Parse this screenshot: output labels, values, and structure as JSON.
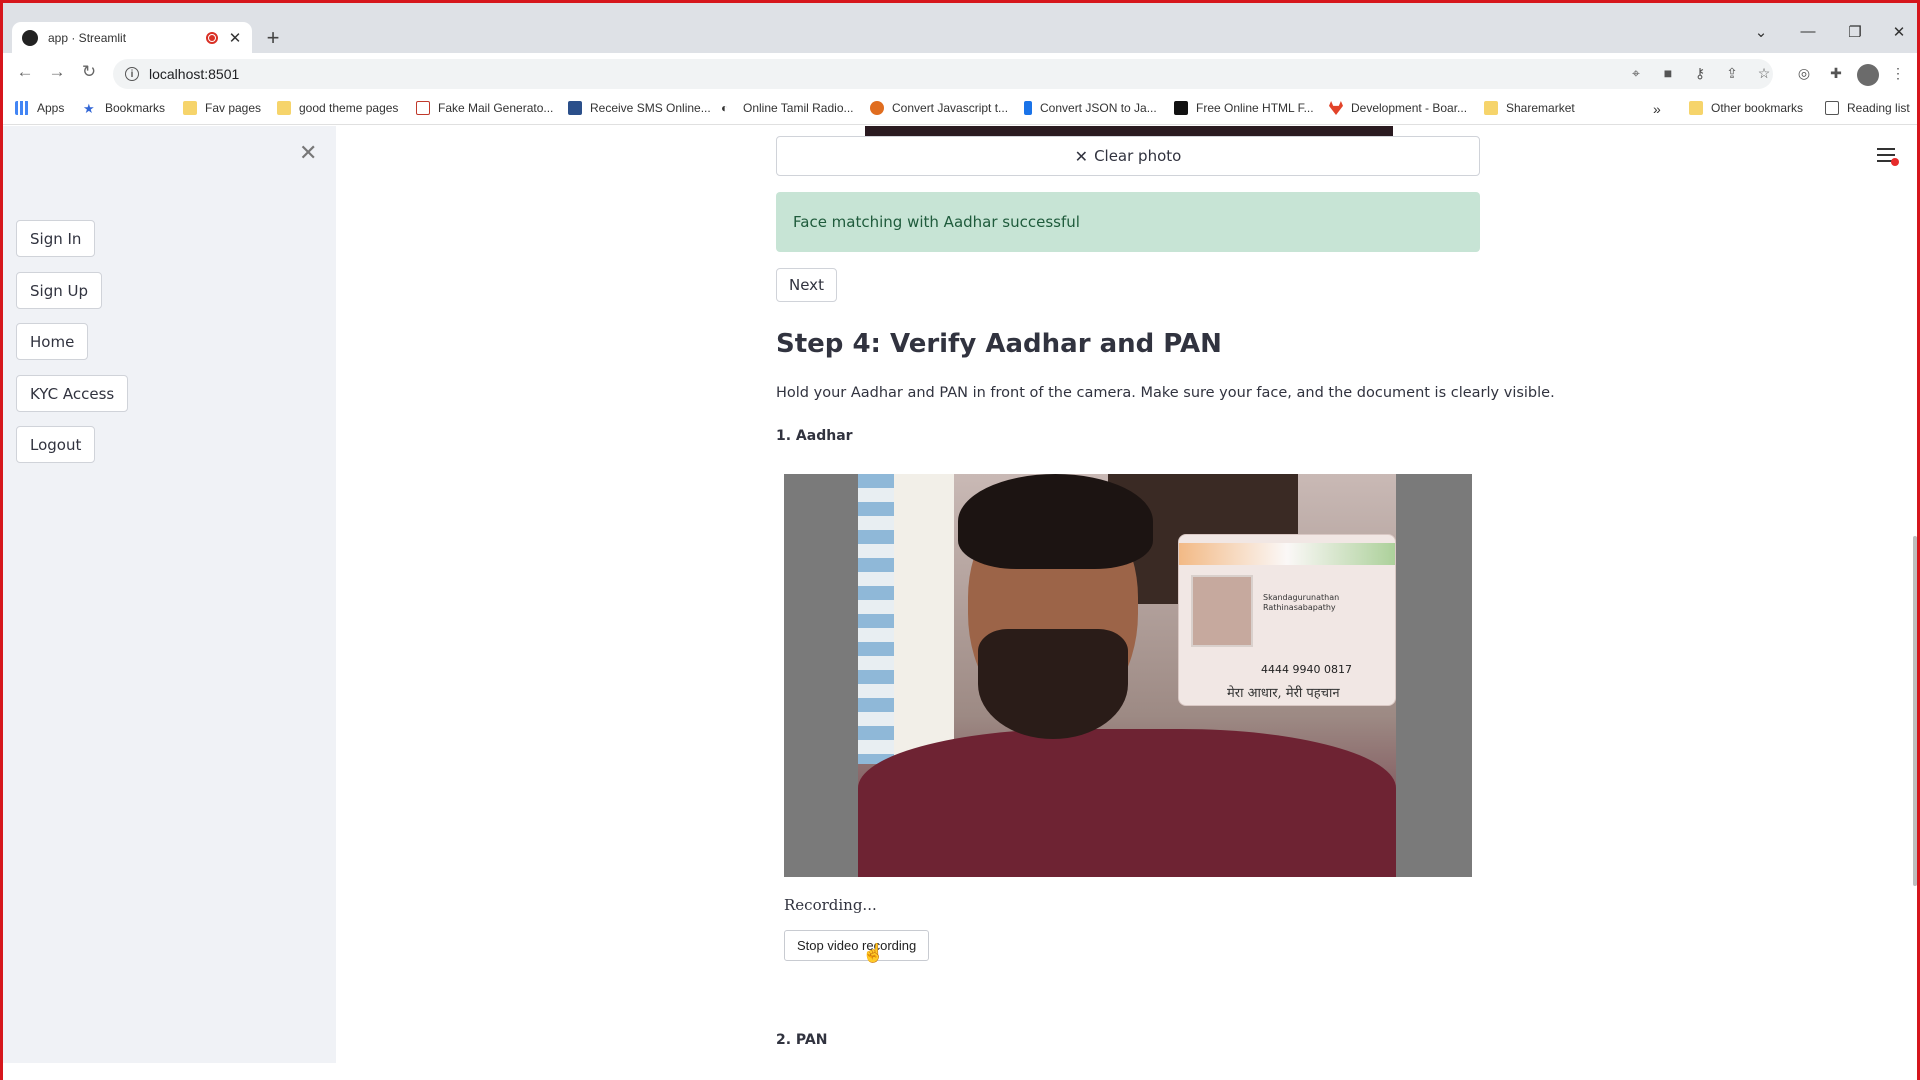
{
  "browser": {
    "tab_title": "app · Streamlit",
    "url": "localhost:8501",
    "bookmarks": [
      {
        "label": "Apps",
        "icon": "apps-grid-icon"
      },
      {
        "label": "Bookmarks",
        "icon": "star-icon"
      },
      {
        "label": "Fav pages",
        "icon": "folder-icon"
      },
      {
        "label": "good theme pages",
        "icon": "folder-icon"
      },
      {
        "label": "Fake Mail Generato...",
        "icon": "mail-icon"
      },
      {
        "label": "Receive SMS Online...",
        "icon": "sms-icon"
      },
      {
        "label": "Online Tamil Radio...",
        "icon": "radio-icon"
      },
      {
        "label": "Convert Javascript t...",
        "icon": "convert-icon"
      },
      {
        "label": "Convert JSON to Ja...",
        "icon": "json-icon"
      },
      {
        "label": "Free Online HTML F...",
        "icon": "html-icon"
      },
      {
        "label": "Development - Boar...",
        "icon": "gitlab-icon"
      },
      {
        "label": "Sharemarket",
        "icon": "folder-icon"
      }
    ],
    "overflow_label": "»",
    "other_bookmarks": "Other bookmarks",
    "reading_list": "Reading list"
  },
  "sidebar": {
    "buttons": [
      "Sign In",
      "Sign Up",
      "Home",
      "KYC Access",
      "Logout"
    ]
  },
  "main": {
    "clear_photo": "Clear photo",
    "success_message": "Face matching with Aadhar successful",
    "next": "Next",
    "step_heading": "Step 4: Verify Aadhar and PAN",
    "instructions": "Hold your Aadhar and PAN in front of the camera. Make sure your face, and the document is clearly visible.",
    "section_aadhar": "1. Aadhar",
    "card_name": "Skandagurunathan Rathinasabapathy",
    "card_number": "4444 9940 0817",
    "card_motto": "मेरा आधार, मेरी पहचान",
    "recording_status": "Recording...",
    "stop_button": "Stop video recording",
    "section_pan": "2. PAN"
  },
  "colors": {
    "success_bg": "#c7e4d5",
    "sidebar_bg": "#f0f2f6",
    "window_border": "#d6161c"
  }
}
